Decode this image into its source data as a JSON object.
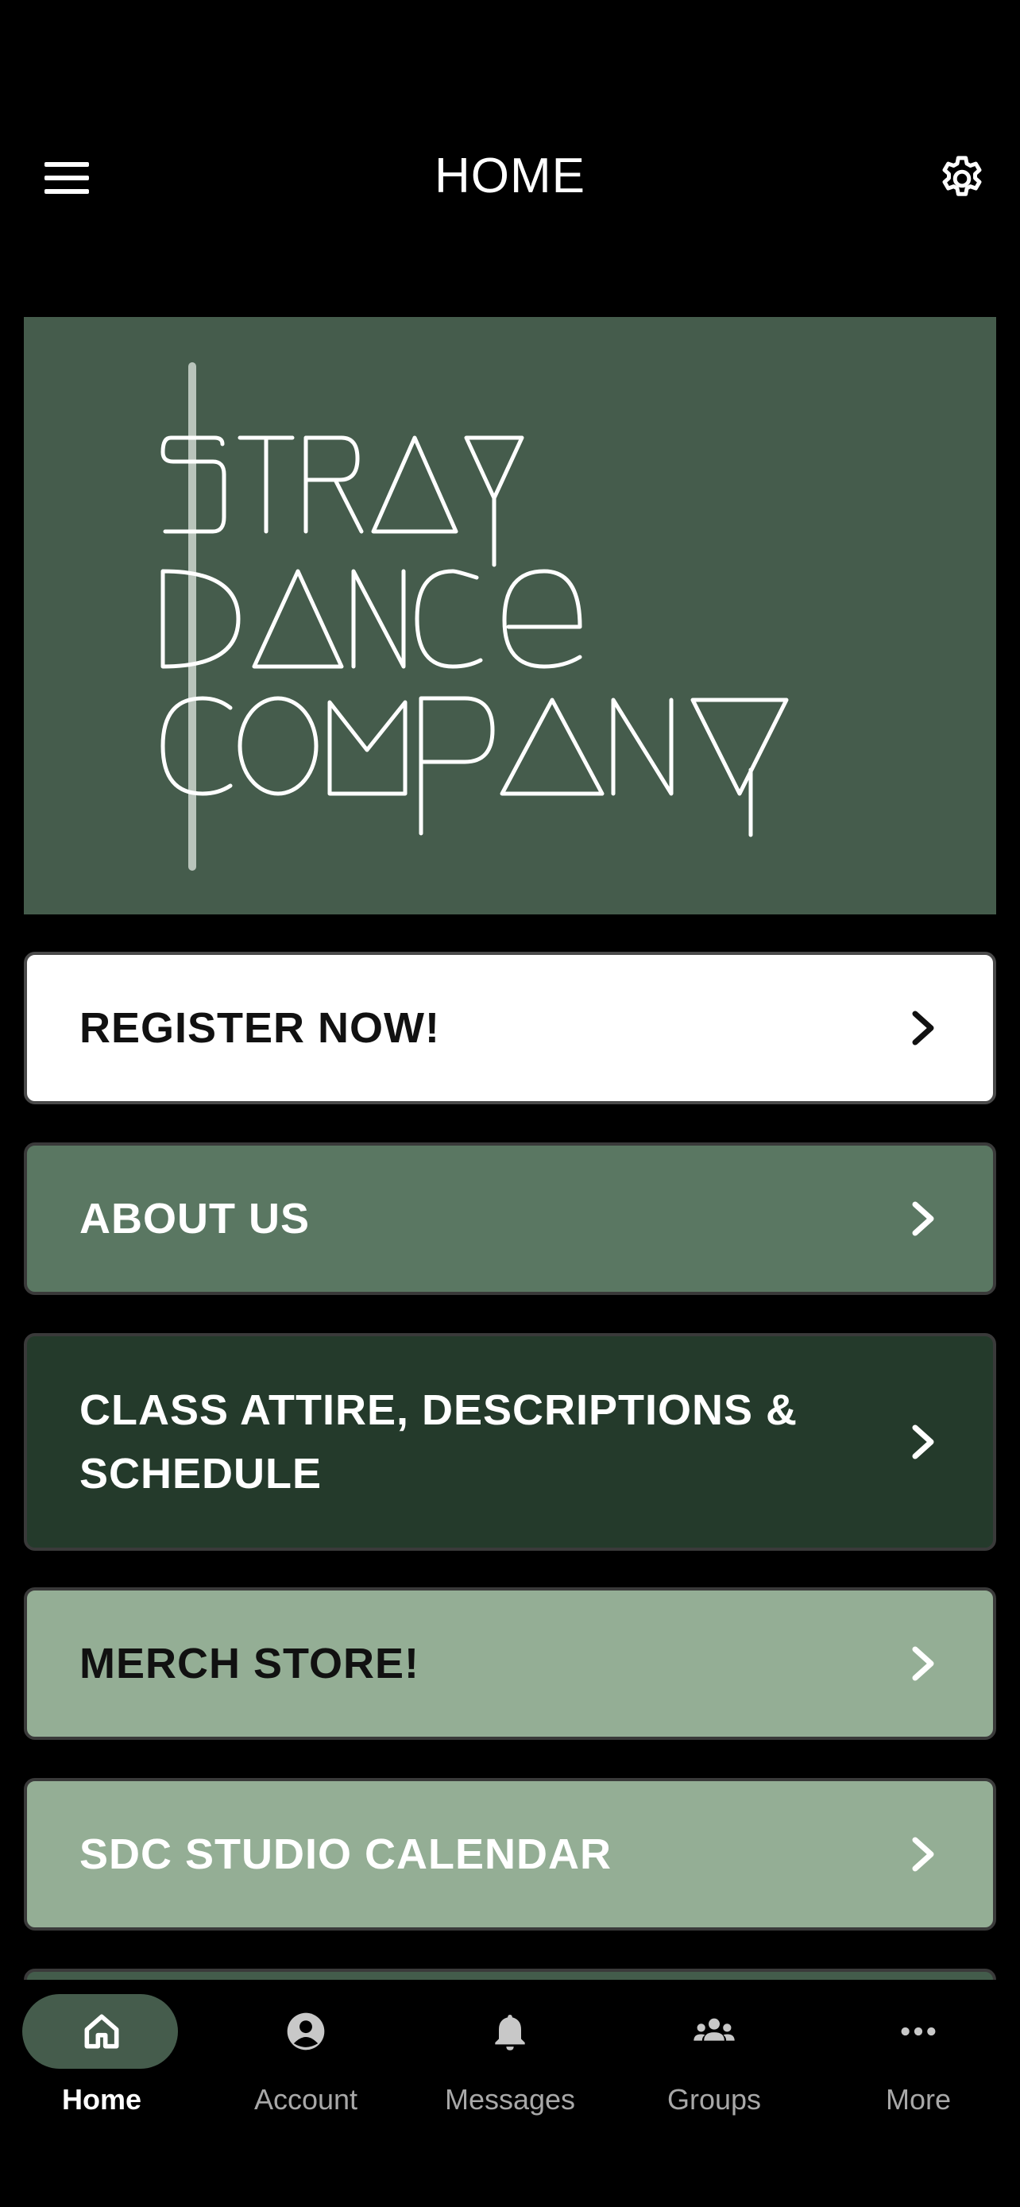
{
  "header": {
    "title": "HOME",
    "menu_icon": "hamburger-menu-icon",
    "settings_icon": "gear-icon"
  },
  "banner": {
    "logo_lines": [
      "STRAY",
      "DANCE",
      "COMPANY"
    ],
    "background_color": "#455c4c"
  },
  "menu": [
    {
      "label": "REGISTER NOW!",
      "bg": "#ffffff",
      "text_color": "#111111"
    },
    {
      "label": "ABOUT US",
      "bg": "#5a7762",
      "text_color": "#ffffff"
    },
    {
      "label": "CLASS ATTIRE, DESCRIPTIONS & SCHEDULE",
      "bg": "#243a2b",
      "text_color": "#ffffff"
    },
    {
      "label": "MERCH STORE!",
      "bg": "#94ae95",
      "text_color": "#111111"
    },
    {
      "label": "SDC STUDIO CALENDAR",
      "bg": "#94ae95",
      "text_color": "#ffffff"
    }
  ],
  "tabbar": {
    "tabs": [
      {
        "label": "Home",
        "icon": "home-icon",
        "active": true
      },
      {
        "label": "Account",
        "icon": "account-circle-icon",
        "active": false
      },
      {
        "label": "Messages",
        "icon": "bell-icon",
        "active": false
      },
      {
        "label": "Groups",
        "icon": "groups-icon",
        "active": false
      },
      {
        "label": "More",
        "icon": "more-dots-icon",
        "active": false
      }
    ],
    "active_color": "#455c4c"
  }
}
